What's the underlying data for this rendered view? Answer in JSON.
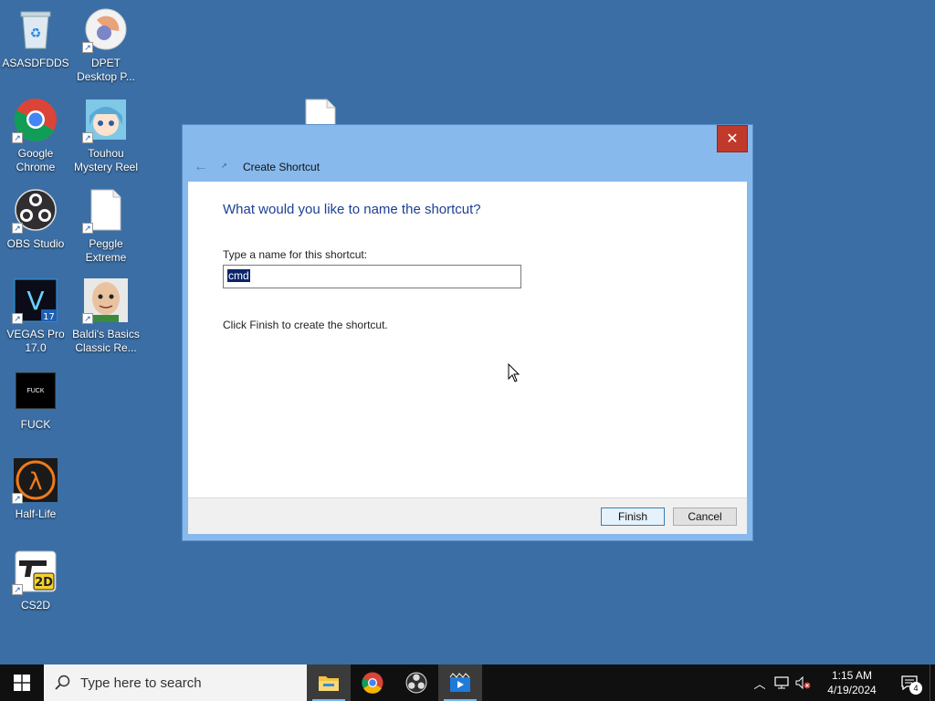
{
  "desktop": {
    "icons": [
      {
        "label": "ASASDFDDS",
        "icon": "recycle-bin-icon"
      },
      {
        "label": "DPET\nDesktop P...",
        "icon": "dpet-icon"
      },
      {
        "label": "Google\nChrome",
        "icon": "chrome-icon"
      },
      {
        "label": "Touhou\nMystery Reel",
        "icon": "touhou-icon"
      },
      {
        "label": "OBS Studio",
        "icon": "obs-icon"
      },
      {
        "label": "Peggle\nExtreme",
        "icon": "blank-file-icon"
      },
      {
        "label": "VEGAS Pro\n17.0",
        "icon": "vegas-icon"
      },
      {
        "label": "Baldi's Basics\nClassic Re...",
        "icon": "baldi-icon"
      },
      {
        "label": "FUCK",
        "icon": "black-app-icon",
        "icon_text": "FUCK"
      },
      {
        "label": "Half-Life",
        "icon": "half-life-icon"
      },
      {
        "label": "CS2D",
        "icon": "cs2d-icon",
        "icon_text": "2D"
      }
    ]
  },
  "dialog": {
    "title": "Create Shortcut",
    "heading": "What would you like to name the shortcut?",
    "field_label": "Type a name for this shortcut:",
    "field_value": "cmd",
    "hint": "Click Finish to create the shortcut.",
    "finish_label": "Finish",
    "cancel_label": "Cancel",
    "close_glyph": "✕"
  },
  "vegas_version": "17",
  "taskbar": {
    "search_placeholder": "Type here to search",
    "clock_time": "1:15 AM",
    "clock_date": "4/19/2024",
    "notification_count": "4",
    "apps": [
      "file-explorer-icon",
      "chrome-icon",
      "obs-icon",
      "media-player-icon"
    ]
  }
}
